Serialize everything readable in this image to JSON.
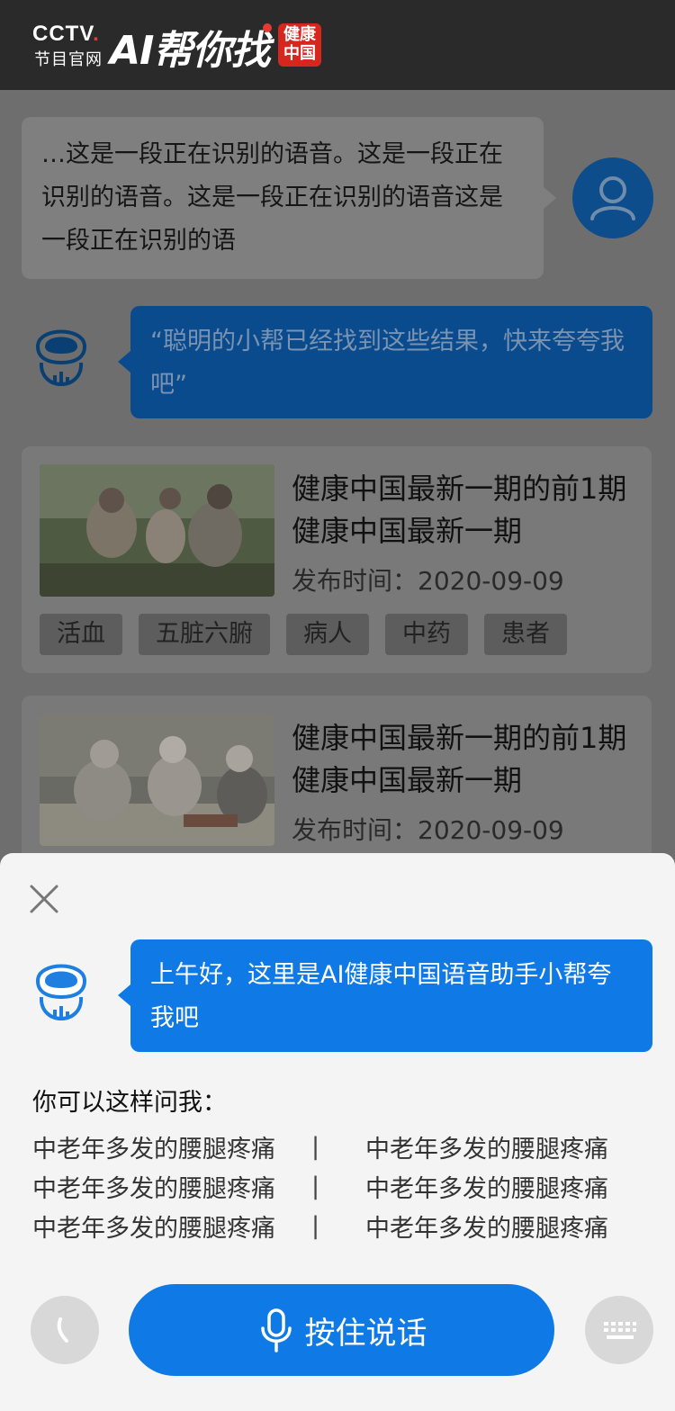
{
  "header": {
    "brand": "CCTV",
    "brand_dot": ".",
    "brand_sub": "节目官网",
    "app_name": "AI帮你找",
    "seal_text": "健康中国"
  },
  "conversation": {
    "user_speech": "…这是一段正在识别的语音。这是一段正在识别的语音。这是一段正在识别的语音这是一段正在识别的语",
    "bot_reply": "“聪明的小帮已经找到这些结果，快来夸夸我吧”"
  },
  "results": [
    {
      "title": "健康中国最新一期的前1期健康中国最新一期",
      "date_label": "发布时间：",
      "date": "2020-09-09",
      "tags": [
        "活血",
        "五脏六腑",
        "病人",
        "中药",
        "患者"
      ]
    },
    {
      "title": "健康中国最新一期的前1期健康中国最新一期",
      "date_label": "发布时间：",
      "date": "2020-09-09"
    }
  ],
  "sheet": {
    "greeting": "上午好，这里是AI健康中国语音助手小帮夸我吧",
    "ask_title": "你可以这样问我：",
    "separator": "|",
    "suggestions": [
      [
        "中老年多发的腰腿疼痛",
        "中老年多发的腰腿疼痛"
      ],
      [
        "中老年多发的腰腿疼痛",
        "中老年多发的腰腿疼痛"
      ],
      [
        "中老年多发的腰腿疼痛",
        "中老年多发的腰腿疼痛"
      ]
    ],
    "talk_button_label": "按住说话"
  },
  "colors": {
    "accent_blue": "#0f7ae5",
    "header_bg": "#2a2a2a",
    "seal_red": "#d7261e"
  }
}
